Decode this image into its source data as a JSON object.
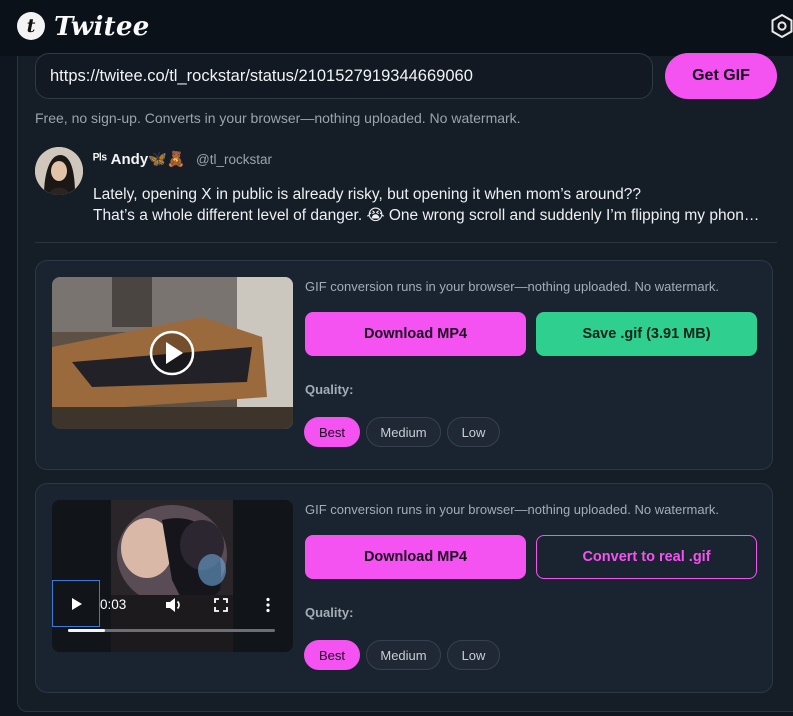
{
  "app": {
    "brand_initial": "t",
    "brand_name": "Twitee"
  },
  "search": {
    "url_value": "https://twitee.co/tl_rockstar/status/2101527919344669060",
    "get_gif_label": "Get GIF",
    "hint": "Free, no sign-up. Converts in your browser—nothing uploaded. No watermark."
  },
  "tweet": {
    "author_name": "ᴾˡˢ Andy🦋🧸",
    "handle": "@tl_rockstar",
    "line1": "Lately, opening X in public is already risky, but opening it when mom’s around??",
    "line2": "That’s a whole different level of danger. 😭 One wrong scroll and suddenly I’m flipping my phon…"
  },
  "media": [
    {
      "hint": "GIF conversion runs in your browser—nothing uploaded. No watermark.",
      "download_mp4_label": "Download MP4",
      "secondary_label": "Save .gif (3.91 MB)",
      "quality_label": "Quality:",
      "quality_options": [
        "Best",
        "Medium",
        "Low"
      ],
      "quality_selected": "Best"
    },
    {
      "hint": "GIF conversion runs in your browser—nothing uploaded. No watermark.",
      "download_mp4_label": "Download MP4",
      "secondary_label": "Convert to real .gif",
      "quality_label": "Quality:",
      "quality_options": [
        "Best",
        "Medium",
        "Low"
      ],
      "quality_selected": "Best",
      "video_time": "0:03",
      "video_progress": 0.18
    }
  ],
  "colors": {
    "accent": "#f553f1",
    "success": "#2fd08f",
    "background": "#151d27"
  },
  "icons": {
    "settings": "hexagon-gear-icon",
    "play": "play-icon",
    "volume": "volume-icon",
    "fullscreen": "fullscreen-icon",
    "more": "more-vertical-icon"
  }
}
